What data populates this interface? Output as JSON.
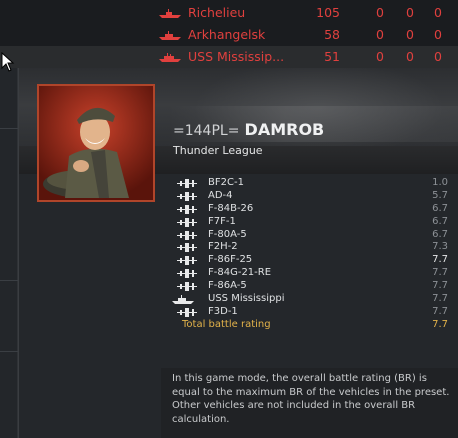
{
  "scoreboard": {
    "rows": [
      {
        "name": "Richelieu",
        "score": "105",
        "a": "0",
        "b": "0",
        "c": "0"
      },
      {
        "name": "Arkhangelsk",
        "score": "58",
        "a": "0",
        "b": "0",
        "c": "0"
      },
      {
        "name": "USS Mississip...",
        "score": "51",
        "a": "0",
        "b": "0",
        "c": "0"
      }
    ],
    "row_color": "#e0403e"
  },
  "player": {
    "squad_tag": "=144PL=",
    "nickname": "DAMROB",
    "title": "Thunder League"
  },
  "vehicles": [
    {
      "icon": "plane-icon",
      "name": "BF2C-1",
      "br": "1.0",
      "highlight": false
    },
    {
      "icon": "plane-icon",
      "name": "AD-4",
      "br": "5.7",
      "highlight": false
    },
    {
      "icon": "plane-icon",
      "name": "F-84B-26",
      "br": "6.7",
      "highlight": false
    },
    {
      "icon": "plane-icon",
      "name": "F7F-1",
      "br": "6.7",
      "highlight": false
    },
    {
      "icon": "plane-icon",
      "name": "F-80A-5",
      "br": "6.7",
      "highlight": false
    },
    {
      "icon": "plane-icon",
      "name": "F2H-2",
      "br": "7.3",
      "highlight": false
    },
    {
      "icon": "plane-icon",
      "name": "F-86F-25",
      "br": "7.7",
      "highlight": true
    },
    {
      "icon": "plane-icon",
      "name": "F-84G-21-RE",
      "br": "7.7",
      "highlight": false
    },
    {
      "icon": "plane-icon",
      "name": "F-86A-5",
      "br": "7.7",
      "highlight": false
    },
    {
      "icon": "ship-icon",
      "name": "USS Mississippi",
      "br": "7.7",
      "highlight": false
    },
    {
      "icon": "plane-icon",
      "name": "F3D-1",
      "br": "7.7",
      "highlight": false
    }
  ],
  "total": {
    "label": "Total battle rating",
    "br": "7.7"
  },
  "note": "In this game mode, the overall battle rating (BR) is equal to the maximum BR of the vehicles in the preset. Other vehicles are not included in the overall BR calculation.",
  "colors": {
    "accent_gold": "#e2b24a",
    "enemy_red": "#e0403e",
    "avatar_border": "#b0452a"
  }
}
